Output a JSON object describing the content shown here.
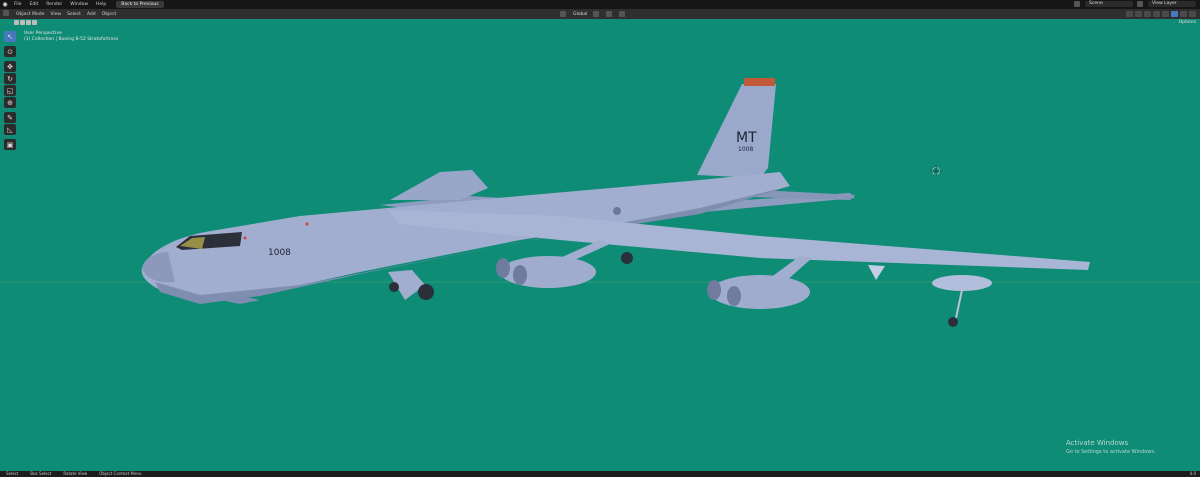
{
  "topbar": {
    "menus": [
      "File",
      "Edit",
      "Render",
      "Window",
      "Help"
    ],
    "workspace_tab": "Back to Previous",
    "scene_label": "Scene",
    "view_layer_label": "View Layer"
  },
  "header": {
    "mode": "Object Mode",
    "menus": [
      "View",
      "Select",
      "Add",
      "Object"
    ],
    "orientation": "Global"
  },
  "viewport": {
    "perspective_label": "User Perspective",
    "collection_label": "(1) Collection | Boeing B-52 Stratofortress",
    "options_label": "Options",
    "background_color": "#0f8c76",
    "tail_code": "MT",
    "tail_number": "1008",
    "nose_number": "1008"
  },
  "toolbar": {
    "tools": [
      {
        "name": "select-box-tool",
        "glyph": "↖"
      },
      {
        "name": "cursor-tool",
        "glyph": "⊙"
      },
      {
        "name": "move-tool",
        "glyph": "✥"
      },
      {
        "name": "rotate-tool",
        "glyph": "↻"
      },
      {
        "name": "scale-tool",
        "glyph": "◱"
      },
      {
        "name": "transform-tool",
        "glyph": "⊕"
      },
      {
        "name": "annotate-tool",
        "glyph": "✎"
      },
      {
        "name": "measure-tool",
        "glyph": "◺"
      },
      {
        "name": "add-cube-tool",
        "glyph": "▣"
      }
    ]
  },
  "statusbar": {
    "items": [
      "Select",
      "Box Select",
      "Rotate View",
      "Object Context Menu"
    ],
    "version": "4.0"
  },
  "activate_windows": {
    "title": "Activate Windows",
    "subtitle": "Go to Settings to activate Windows."
  }
}
